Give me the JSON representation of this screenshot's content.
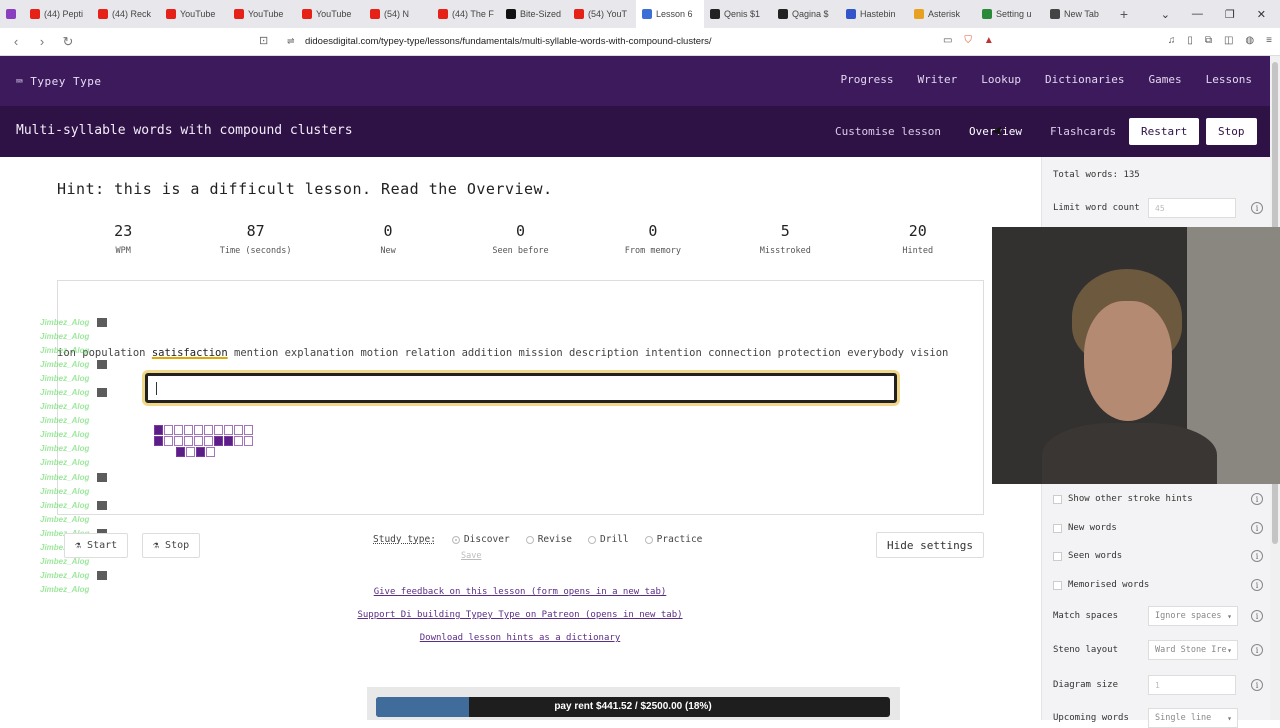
{
  "browser": {
    "tabs": [
      {
        "label": "(44) Pepti",
        "color": "#e62117"
      },
      {
        "label": "(44) Reck",
        "color": "#e62117"
      },
      {
        "label": "YouTube",
        "color": "#e62117"
      },
      {
        "label": "YouTube",
        "color": "#e62117"
      },
      {
        "label": "YouTube",
        "color": "#e62117"
      },
      {
        "label": "(54) N",
        "color": "#e62117"
      },
      {
        "label": "(44) The F",
        "color": "#e62117"
      },
      {
        "label": "Bite-Sized",
        "color": "#111111"
      },
      {
        "label": "(54) YouT",
        "color": "#e62117"
      },
      {
        "label": "Lesson 6",
        "color": "#3b6fd6"
      },
      {
        "label": "Qenis $1",
        "color": "#222222"
      },
      {
        "label": "Qagina $",
        "color": "#222222"
      },
      {
        "label": "Hastebin",
        "color": "#3355cc"
      },
      {
        "label": "Asterisk",
        "color": "#e8a020"
      },
      {
        "label": "Setting u",
        "color": "#2a8a3a"
      },
      {
        "label": "New Tab",
        "color": "#444444"
      }
    ],
    "url": "didoesdigital.com/typey-type/lessons/fundamentals/multi-syllable-words-with-compound-clusters/"
  },
  "site": {
    "logo": "Typey Type",
    "nav": [
      "Progress",
      "Writer",
      "Lookup",
      "Dictionaries",
      "Games",
      "Lessons"
    ]
  },
  "lesson": {
    "title": "Multi-syllable words with compound clusters",
    "links": {
      "customise": "Customise lesson",
      "overview": "Overview",
      "flashcards": "Flashcards"
    },
    "restart": "Restart",
    "stop": "Stop",
    "hint": "Hint: this is a difficult lesson. Read the Overview.",
    "stats": [
      {
        "value": "23",
        "label": "WPM"
      },
      {
        "value": "87",
        "label": "Time (seconds)"
      },
      {
        "value": "0",
        "label": "New"
      },
      {
        "value": "0",
        "label": "Seen before"
      },
      {
        "value": "0",
        "label": "From memory"
      },
      {
        "value": "5",
        "label": "Misstroked"
      },
      {
        "value": "20",
        "label": "Hinted"
      }
    ],
    "material_before": "ion population ",
    "material_current": "satisfaction",
    "material_after": " mention explanation motion relation addition mission description intention connection protection everybody vision",
    "start_button": "Start",
    "stop_button": "Stop",
    "study_type_label": "Study type:",
    "study_types": [
      "Discover",
      "Revise",
      "Drill",
      "Practice"
    ],
    "study_type_selected": "Discover",
    "save_label": "Save",
    "hide_settings": "Hide settings",
    "footer_links": [
      "Give feedback on this lesson (form opens in a new tab)",
      "Support Di building Typey Type on Patreon (opens in new tab)",
      "Download lesson hints as a dictionary"
    ]
  },
  "chat": {
    "username": "Jimbez_Alog",
    "line_count": 20
  },
  "donation": {
    "text": "pay rent $441.52 / $2500.00 (18%)",
    "progress": 0.18
  },
  "sidebar": {
    "total_words": "Total words: 135",
    "limit_word_count_label": "Limit word count",
    "limit_word_count_value": "45",
    "show_other_stroke_hints": "Show other stroke hints",
    "new_words": "New words",
    "seen_words": "Seen words",
    "memorised_words": "Memorised words",
    "match_spaces_label": "Match spaces",
    "match_spaces_value": "Ignore spaces",
    "steno_layout_label": "Steno layout",
    "steno_layout_value": "Ward Stone Ire",
    "diagram_size_label": "Diagram size",
    "diagram_size_value": "1",
    "upcoming_words_label": "Upcoming words",
    "upcoming_words_value": "Single line"
  }
}
